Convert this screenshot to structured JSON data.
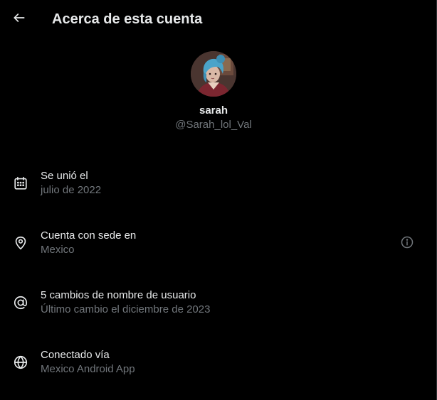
{
  "header": {
    "title": "Acerca de esta cuenta",
    "back_icon": "arrow-left-icon"
  },
  "profile": {
    "display_name": "sarah",
    "handle": "@Sarah_lol_Val",
    "avatar_icon": "avatar-image"
  },
  "info": [
    {
      "icon": "calendar-icon",
      "title": "Se unió el",
      "subtitle": "julio de 2022"
    },
    {
      "icon": "location-pin-icon",
      "title": "Cuenta con sede en",
      "subtitle": "Mexico",
      "extra_icon": "info-icon"
    },
    {
      "icon": "at-sign-icon",
      "title": "5 cambios de nombre de usuario",
      "subtitle": "Último cambio el diciembre de 2023"
    },
    {
      "icon": "globe-icon",
      "title": "Conectado vía",
      "subtitle": "Mexico Android App"
    }
  ],
  "colors": {
    "background": "#000000",
    "primary_text": "#e7e9ea",
    "secondary_text": "#71767b",
    "border": "#2f3336"
  }
}
